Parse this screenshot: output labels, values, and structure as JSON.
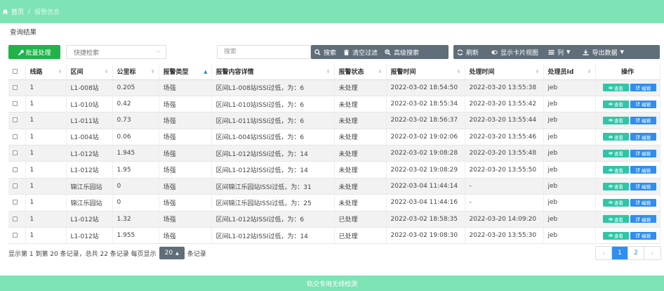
{
  "breadcrumb": {
    "home": "首页",
    "separator": "/",
    "current": "报警信息"
  },
  "section_title": "查询结果",
  "toolbar": {
    "batch_label": "批量处理",
    "quick_search_label": "快捷检索",
    "search_placeholder": "搜索",
    "search_label": "搜索",
    "clear_filter_label": "清空过滤",
    "advanced_search_label": "高级搜索",
    "refresh_label": "刷新",
    "card_view_label": "显示卡片视图",
    "columns_label": "列",
    "export_label": "导出数据"
  },
  "table": {
    "headers": {
      "line": "线路",
      "section": "区间",
      "km": "公里标",
      "alarm_type": "报警类型",
      "detail": "报警内容详情",
      "status": "报警状态",
      "alarm_time": "报警时间",
      "handle_time": "处理时间",
      "handler_id": "处理员Id",
      "ops": "操作"
    },
    "view_label": "查看",
    "edit_label": "编辑",
    "rows": [
      {
        "line": "1",
        "section": "L1-008站",
        "km": "0.205",
        "type": "场强",
        "detail": "区间L1-008站ISSI过低，为：6",
        "status": "未处理",
        "alarm_time": "2022-03-02 18:54:50",
        "handle_time": "2022-03-20 13:55:38",
        "handler": "jeb"
      },
      {
        "line": "1",
        "section": "L1-010站",
        "km": "0.42",
        "type": "场强",
        "detail": "区间L1-010站ISSI过低，为：6",
        "status": "未处理",
        "alarm_time": "2022-03-02 18:55:34",
        "handle_time": "2022-03-20 13:55:42",
        "handler": "jeb"
      },
      {
        "line": "1",
        "section": "L1-011站",
        "km": "0.73",
        "type": "场强",
        "detail": "区间L1-011站ISSI过低，为：6",
        "status": "未处理",
        "alarm_time": "2022-03-02 18:56:37",
        "handle_time": "2022-03-20 13:55:44",
        "handler": "jeb"
      },
      {
        "line": "1",
        "section": "L1-004站",
        "km": "0.06",
        "type": "场强",
        "detail": "区间L1-004站ISSI过低，为：6",
        "status": "未处理",
        "alarm_time": "2022-03-02 19:02:06",
        "handle_time": "2022-03-20 13:55:46",
        "handler": "jeb"
      },
      {
        "line": "1",
        "section": "L1-012站",
        "km": "1.945",
        "type": "场强",
        "detail": "区间L1-012站ISSI过低，为：14",
        "status": "未处理",
        "alarm_time": "2022-03-02 19:08:28",
        "handle_time": "2022-03-20 13:55:48",
        "handler": "jeb"
      },
      {
        "line": "1",
        "section": "L1-012站",
        "km": "1.95",
        "type": "场强",
        "detail": "区间L1-012站ISSI过低，为：14",
        "status": "未处理",
        "alarm_time": "2022-03-02 19:08:29",
        "handle_time": "2022-03-20 13:55:50",
        "handler": "jeb"
      },
      {
        "line": "1",
        "section": "锦江乐园站",
        "km": "0",
        "type": "场强",
        "detail": "区间锦江乐园站ISSI过低，为：31",
        "status": "未处理",
        "alarm_time": "2022-03-04 11:44:14",
        "handle_time": "-",
        "handler": "jeb"
      },
      {
        "line": "1",
        "section": "锦江乐园站",
        "km": "0",
        "type": "场强",
        "detail": "区间锦江乐园站ISSI过低，为：25",
        "status": "未处理",
        "alarm_time": "2022-03-04 11:44:16",
        "handle_time": "-",
        "handler": "jeb"
      },
      {
        "line": "1",
        "section": "L1-012站",
        "km": "1.32",
        "type": "场强",
        "detail": "区间L1-012站ISSI过低，为：6",
        "status": "已处理",
        "alarm_time": "2022-03-02 18:58:35",
        "handle_time": "2022-03-20 14:09:20",
        "handler": "jeb"
      },
      {
        "line": "1",
        "section": "L1-012站",
        "km": "1.955",
        "type": "场强",
        "detail": "区间L1-012站ISSI过低，为：14",
        "status": "已处理",
        "alarm_time": "2022-03-02 19:08:30",
        "handle_time": "2022-03-20 13:55:30",
        "handler": "jeb"
      }
    ]
  },
  "footer": {
    "info_prefix": "显示第 1 到第 20 条记录，总共 22 条记录 每页显示",
    "page_size": "20",
    "info_suffix": "条记录",
    "pages": [
      "1",
      "2"
    ],
    "prev": "‹",
    "next": "›"
  },
  "bottom_bar": "轨交专用无线检测",
  "colors": {
    "header_green": "#7ee3b5",
    "pending_red": "#e91e63",
    "btn_gray": "#5f6e78",
    "primary_blue": "#2f8ef0",
    "view_teal": "#2ec6a6",
    "batch_green": "#20b34a"
  }
}
